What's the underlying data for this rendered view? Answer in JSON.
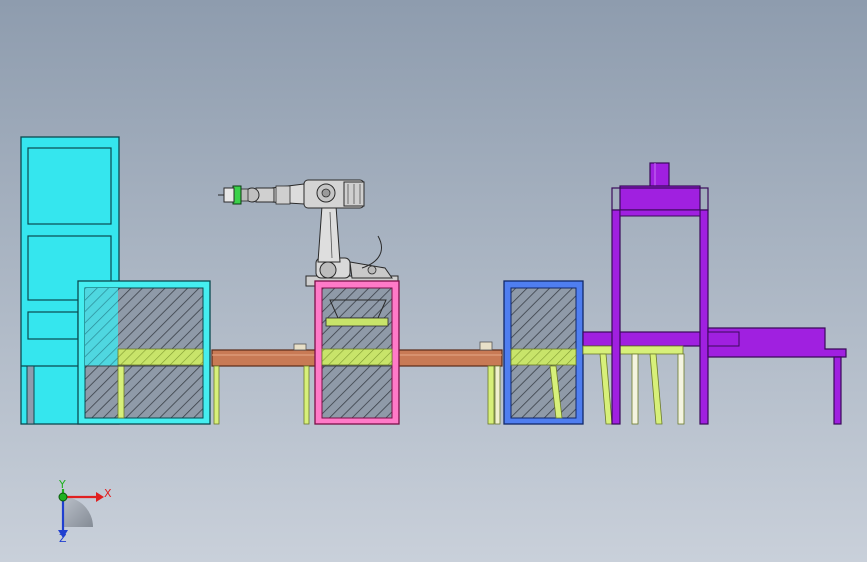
{
  "viewport": {
    "background_top": "#8e9cae",
    "background_bottom": "#c9d0da"
  },
  "colors": {
    "cabinet": "#35e6ee",
    "guard_cyan": "#45eef0",
    "guard_pink": "#ff7ac8",
    "guard_blue": "#4f7ef0",
    "press_purple": "#a020e0",
    "conveyor": "#c87a55",
    "fixture_yellow": "#d7f07a",
    "hatch_fill": "#8f9aa8",
    "robot": "#d9d9d9"
  },
  "triad": {
    "x_label": "X",
    "y_label": "Y",
    "z_label": "Z",
    "x_color": "#e02020",
    "y_color": "#20b020",
    "z_color": "#2040d0"
  }
}
